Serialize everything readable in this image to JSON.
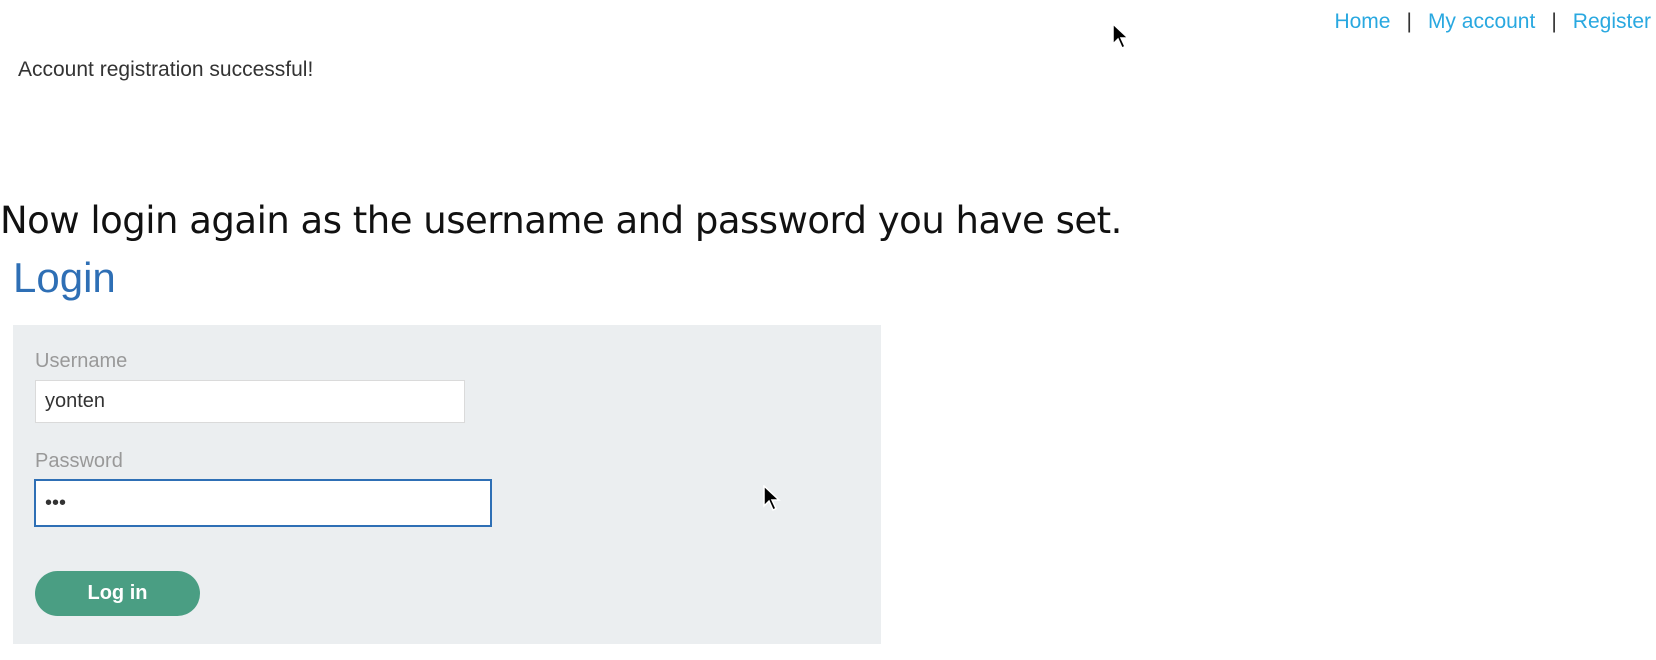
{
  "nav": {
    "items": [
      {
        "label": "Home"
      },
      {
        "label": "My account"
      },
      {
        "label": "Register"
      }
    ],
    "separator": "|"
  },
  "status": {
    "message": "Account registration successful!"
  },
  "instruction": {
    "text": "Now login again as the username and password you have set."
  },
  "login": {
    "heading": "Login",
    "username_label": "Username",
    "username_value": "yonten",
    "password_label": "Password",
    "password_value": "abc",
    "submit_label": "Log in"
  },
  "colors": {
    "link": "#29a8e0",
    "heading": "#2e6fb5",
    "panel_bg": "#ebeef0",
    "button_bg": "#4a9e83"
  }
}
